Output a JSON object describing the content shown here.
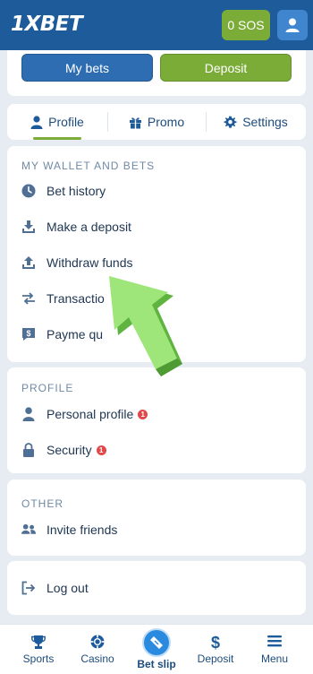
{
  "header": {
    "logo_text": "1XBET",
    "balance_label": "0 SOS"
  },
  "top_actions": {
    "my_bets_label": "My bets",
    "deposit_label": "Deposit"
  },
  "tabs": [
    {
      "label": "Profile"
    },
    {
      "label": "Promo"
    },
    {
      "label": "Settings"
    }
  ],
  "sections": {
    "wallet": {
      "title": "MY WALLET AND BETS",
      "items": [
        {
          "label": "Bet history",
          "icon": "clock-icon"
        },
        {
          "label": "Make a deposit",
          "icon": "download-icon"
        },
        {
          "label": "Withdraw funds",
          "icon": "upload-icon"
        },
        {
          "label": "Transactio",
          "icon": "transfer-arrows-icon"
        },
        {
          "label": "Payme qu",
          "icon": "payment-dollar-icon"
        }
      ]
    },
    "profile": {
      "title": "PROFILE",
      "items": [
        {
          "label": "Personal profile",
          "badge": "1",
          "icon": "person-icon"
        },
        {
          "label": "Security",
          "badge": "1",
          "icon": "lock-icon"
        }
      ]
    },
    "other": {
      "title": "OTHER",
      "items": [
        {
          "label": "Invite friends",
          "icon": "people-icon"
        }
      ]
    },
    "logout": {
      "label": "Log out",
      "icon": "logout-icon"
    }
  },
  "bottom_nav": [
    {
      "label": "Sports",
      "icon": "trophy-icon"
    },
    {
      "label": "Casino",
      "icon": "chip-icon"
    },
    {
      "label": "Bet slip",
      "icon": "ticket-icon",
      "active": true
    },
    {
      "label": "Deposit",
      "icon": "dollar-icon"
    },
    {
      "label": "Menu",
      "icon": "hamburger-icon"
    }
  ],
  "colors": {
    "header_bg": "#1d5b9a",
    "accent_green": "#7bac38",
    "accent_blue": "#2e6db1",
    "badge_red": "#e0484a"
  }
}
